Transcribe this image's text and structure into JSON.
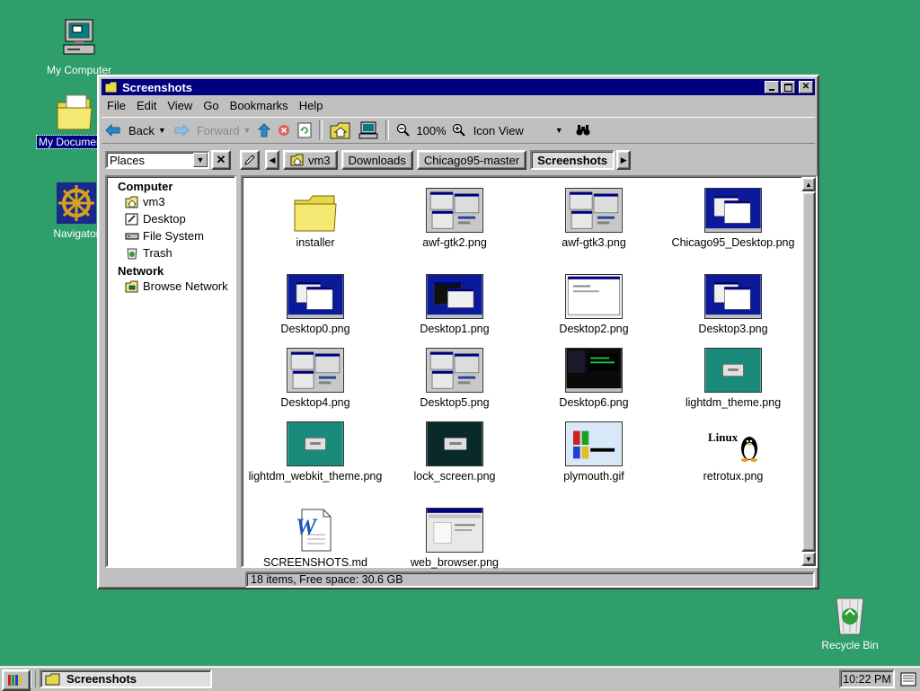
{
  "desktop": {
    "icons": [
      {
        "label": "My Computer"
      },
      {
        "label": "My Documents"
      },
      {
        "label": "Navigator"
      },
      {
        "label": "Recycle Bin"
      }
    ]
  },
  "window": {
    "title": "Screenshots",
    "menu": [
      "File",
      "Edit",
      "View",
      "Go",
      "Bookmarks",
      "Help"
    ],
    "toolbar": {
      "back": "Back",
      "forward": "Forward",
      "zoom": "100%",
      "view_mode": "Icon View"
    },
    "places_select": "Places",
    "breadcrumbs": [
      "vm3",
      "Downloads",
      "Chicago95-master",
      "Screenshots"
    ],
    "sidebar": {
      "computer_heading": "Computer",
      "computer_items": [
        "vm3",
        "Desktop",
        "File System",
        "Trash"
      ],
      "network_heading": "Network",
      "network_items": [
        "Browse Network"
      ]
    },
    "files": [
      {
        "name": "installer",
        "kind": "folder"
      },
      {
        "name": "awf-gtk2.png",
        "kind": "gray"
      },
      {
        "name": "awf-gtk3.png",
        "kind": "gray"
      },
      {
        "name": "Chicago95_Desktop.png",
        "kind": "blue"
      },
      {
        "name": "Desktop0.png",
        "kind": "blue"
      },
      {
        "name": "Desktop1.png",
        "kind": "blue-dark"
      },
      {
        "name": "Desktop2.png",
        "kind": "white"
      },
      {
        "name": "Desktop3.png",
        "kind": "blue"
      },
      {
        "name": "Desktop4.png",
        "kind": "gray"
      },
      {
        "name": "Desktop5.png",
        "kind": "gray"
      },
      {
        "name": "Desktop6.png",
        "kind": "black"
      },
      {
        "name": "lightdm_theme.png",
        "kind": "teal"
      },
      {
        "name": "lightdm_webkit_theme.png",
        "kind": "teal"
      },
      {
        "name": "lock_screen.png",
        "kind": "dark-teal"
      },
      {
        "name": "plymouth.gif",
        "kind": "windows"
      },
      {
        "name": "retrotux.png",
        "kind": "linux"
      },
      {
        "name": "SCREENSHOTS.md",
        "kind": "doc"
      },
      {
        "name": "web_browser.png",
        "kind": "browser"
      }
    ],
    "status": "18 items, Free space: 30.6 GB"
  },
  "taskbar": {
    "task_label": "Screenshots",
    "clock": "10:22 PM"
  }
}
